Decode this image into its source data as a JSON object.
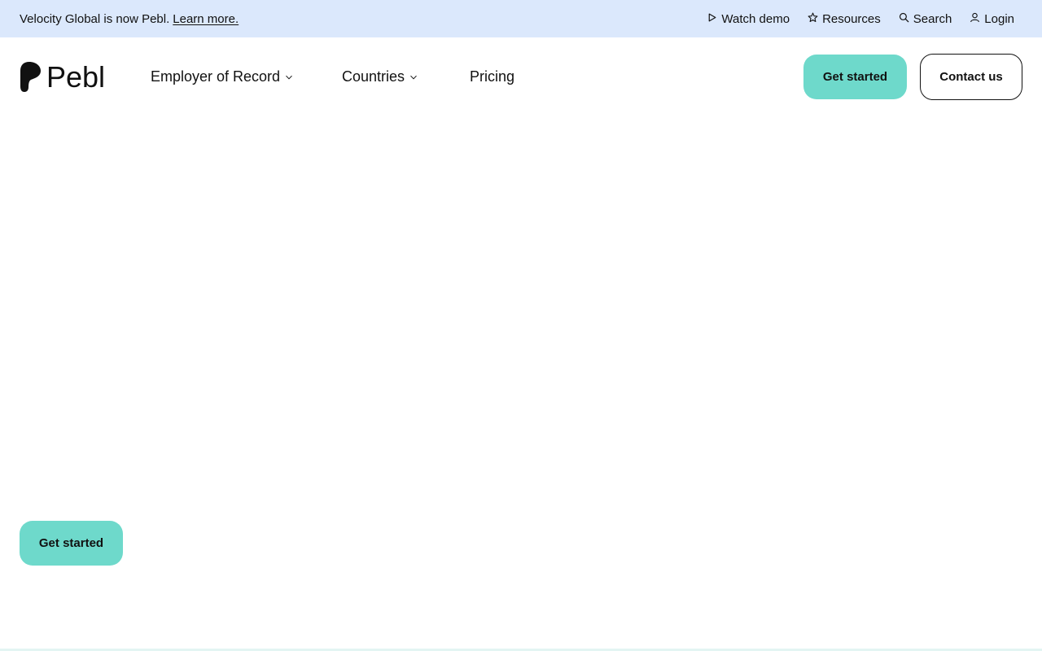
{
  "announcement": {
    "text": "Velocity Global is now Pebl.",
    "link_label": "Learn more."
  },
  "utility": {
    "watch_demo": "Watch demo",
    "resources": "Resources",
    "search": "Search",
    "login": "Login"
  },
  "brand": {
    "name": "Pebl",
    "accent_color": "#6ed9cb",
    "banner_color": "#dbe8fc"
  },
  "nav": {
    "items": [
      {
        "label": "Employer of Record",
        "has_dropdown": true
      },
      {
        "label": "Countries",
        "has_dropdown": true
      },
      {
        "label": "Pricing",
        "has_dropdown": false
      }
    ],
    "get_started": "Get started",
    "contact_us": "Contact us"
  },
  "hero": {
    "cta_label": "Get started"
  }
}
